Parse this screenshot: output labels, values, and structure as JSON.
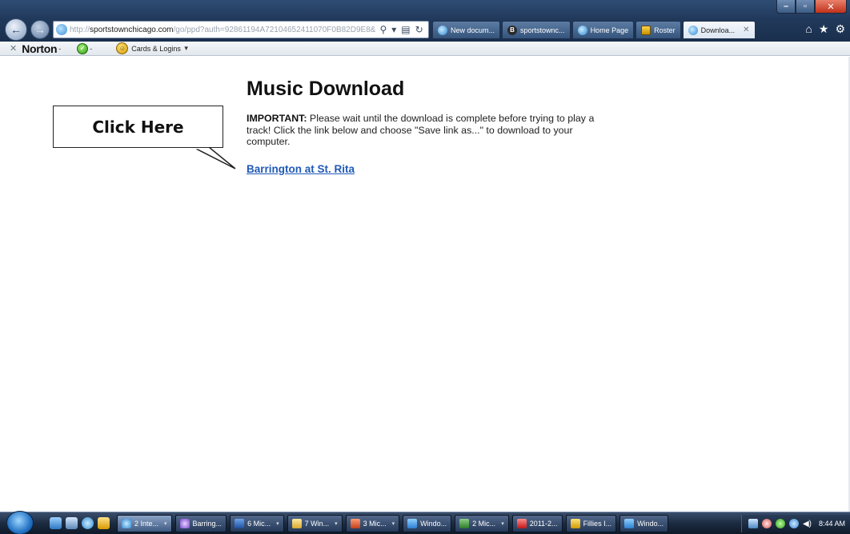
{
  "browser": {
    "address_bar": {
      "scheme": "http://",
      "host": "sportstownchicago.com",
      "path": "/go/ppd?auth=92861194A72104652411070F0B82D9E8&",
      "tools": [
        "search-icon",
        "dropdown-icon",
        "compat-icon",
        "refresh-icon",
        "stop-icon"
      ]
    },
    "tabs": [
      {
        "label": "New docum...",
        "icon": "ie-icon",
        "active": false
      },
      {
        "label": "sportstownc...",
        "icon": "b-icon",
        "active": false
      },
      {
        "label": "Home Page",
        "icon": "ie-icon",
        "active": false
      },
      {
        "label": "Roster",
        "icon": "roster-icon",
        "active": false
      },
      {
        "label": "Downloa...",
        "icon": "ie-icon",
        "active": true
      }
    ],
    "right_icons": [
      "home-icon",
      "favorites-icon",
      "settings-icon"
    ]
  },
  "norton_toolbar": {
    "brand": "Norton",
    "dropdown_marker": "-",
    "cards_label": "Cards & Logins"
  },
  "page": {
    "title": "Music Download",
    "notice_bold": "IMPORTANT:",
    "notice_text": " Please wait until the download is complete before trying to play a track! Click the link below and choose \"Save link as...\" to download to your computer.",
    "download_link": "Barrington at St. Rita",
    "callout_text": "Click Here"
  },
  "taskbar": {
    "items": [
      {
        "label": "2 Inte...",
        "icon": "tk-ie",
        "active": true,
        "arrow": true
      },
      {
        "label": "Barring...",
        "icon": "tk-media",
        "active": false,
        "arrow": false
      },
      {
        "label": "6 Mic...",
        "icon": "tk-word",
        "active": false,
        "arrow": true
      },
      {
        "label": "7 Win...",
        "icon": "tk-folder",
        "active": false,
        "arrow": true
      },
      {
        "label": "3 Mic...",
        "icon": "tk-ppt",
        "active": false,
        "arrow": true
      },
      {
        "label": "Windo...",
        "icon": "tk-win",
        "active": false,
        "arrow": false
      },
      {
        "label": "2 Mic...",
        "icon": "tk-xl",
        "active": false,
        "arrow": true
      },
      {
        "label": "2011-2...",
        "icon": "tk-pdf",
        "active": false,
        "arrow": false
      },
      {
        "label": "Fillies I...",
        "icon": "tk-fav",
        "active": false,
        "arrow": false
      },
      {
        "label": "Windo...",
        "icon": "tk-win",
        "active": false,
        "arrow": false
      }
    ],
    "clock": "8:44 AM"
  }
}
